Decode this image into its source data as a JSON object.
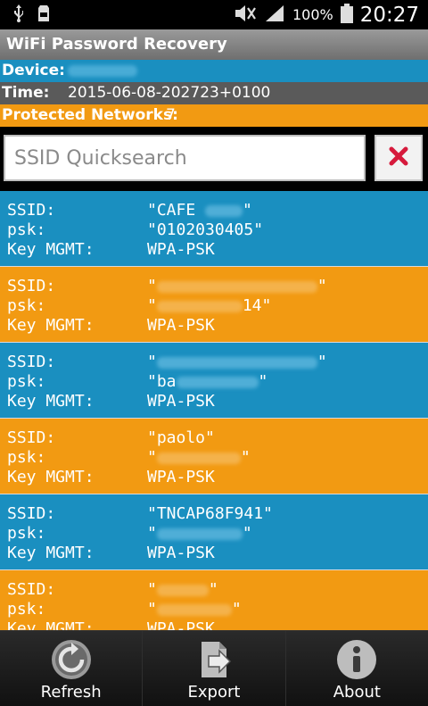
{
  "status_bar": {
    "battery_percent": "100%",
    "time": "20:27",
    "battery_level": 1.0
  },
  "app": {
    "title": "WiFi Password Recovery"
  },
  "info": {
    "device_label": "Device:",
    "time_label": "Time:",
    "time_value": "2015-06-08-202723+0100",
    "protected_label": "Protected Networks:",
    "protected_count": "7"
  },
  "search": {
    "placeholder": "SSID Quicksearch"
  },
  "field_labels": {
    "ssid": "SSID:",
    "psk": "psk:",
    "key_mgmt": "Key MGMT:"
  },
  "networks": [
    {
      "ssid": "\"CAFE ",
      "ssid_tail": "\"",
      "psk": "\"0102030405\"",
      "psk_tail": "",
      "key_mgmt": "WPA-PSK",
      "color": "#1a8fc0"
    },
    {
      "ssid": "\"",
      "ssid_tail": "\"",
      "psk": "\"",
      "psk_tail": "14\"",
      "key_mgmt": "WPA-PSK",
      "color": "#f29a12"
    },
    {
      "ssid": "\"",
      "ssid_tail": "\"",
      "psk": "\"ba",
      "psk_tail": "\"",
      "key_mgmt": "WPA-PSK",
      "color": "#1a8fc0"
    },
    {
      "ssid": "\"paolo\"",
      "ssid_tail": "",
      "psk": "\"",
      "psk_tail": "\"",
      "key_mgmt": "WPA-PSK",
      "color": "#f29a12"
    },
    {
      "ssid": "\"TNCAP68F941\"",
      "ssid_tail": "",
      "psk": "\"",
      "psk_tail": "\"",
      "key_mgmt": "WPA-PSK",
      "color": "#1a8fc0"
    },
    {
      "ssid": "\"",
      "ssid_tail": "\"",
      "psk": "\"",
      "psk_tail": "\"",
      "key_mgmt": "WPA-PSK",
      "color": "#f29a12"
    }
  ],
  "actions": {
    "refresh": "Refresh",
    "export": "Export",
    "about": "About"
  },
  "colors": {
    "blue": "#1a8fc0",
    "orange": "#f29a12",
    "gray_row": "#5a5a5a",
    "clear_icon": "#d61a3c"
  }
}
